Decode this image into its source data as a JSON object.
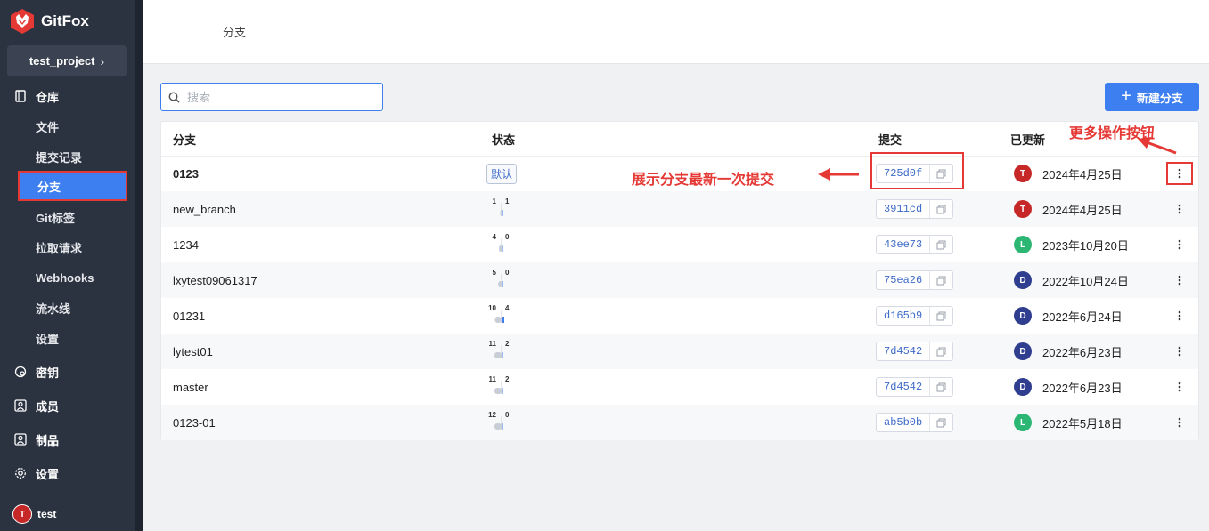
{
  "app": {
    "name": "GitFox",
    "brand_color": "#e53935",
    "accent_color": "#3d7ef0"
  },
  "project": {
    "name": "test_project"
  },
  "sidebar": {
    "repo_label": "仓库",
    "repo_items": [
      {
        "label": "文件",
        "active": false
      },
      {
        "label": "提交记录",
        "active": false
      },
      {
        "label": "分支",
        "active": true
      },
      {
        "label": "Git标签",
        "active": false
      },
      {
        "label": "拉取请求",
        "active": false
      },
      {
        "label": "Webhooks",
        "active": false
      },
      {
        "label": "流水线",
        "active": false
      },
      {
        "label": "设置",
        "active": false
      }
    ],
    "groups": [
      {
        "label": "密钥",
        "icon": "key-icon"
      },
      {
        "label": "成员",
        "icon": "member-icon"
      },
      {
        "label": "制品",
        "icon": "artifact-icon"
      },
      {
        "label": "设置",
        "icon": "gear-icon"
      }
    ],
    "user": {
      "initial": "T",
      "name": "test"
    }
  },
  "header": {
    "title": "分支"
  },
  "search": {
    "placeholder": "搜索",
    "value": ""
  },
  "new_branch_button": {
    "label": "新建分支"
  },
  "table": {
    "columns": {
      "branch": "分支",
      "status": "状态",
      "commit": "提交",
      "updated": "已更新"
    },
    "default_badge": "默认",
    "rows": [
      {
        "name": "0123",
        "is_default": true,
        "behind": null,
        "ahead": null,
        "commit": "725d0f",
        "avatar": "T",
        "avatar_color": "#c62828",
        "updated": "2024年4月25日"
      },
      {
        "name": "new_branch",
        "is_default": false,
        "behind": "1",
        "ahead": "1",
        "commit": "3911cd",
        "avatar": "T",
        "avatar_color": "#c62828",
        "updated": "2024年4月25日"
      },
      {
        "name": "1234",
        "is_default": false,
        "behind": "4",
        "ahead": "0",
        "commit": "43ee73",
        "avatar": "L",
        "avatar_color": "#2bb673",
        "updated": "2023年10月20日"
      },
      {
        "name": "lxytest09061317",
        "is_default": false,
        "behind": "5",
        "ahead": "0",
        "commit": "75ea26",
        "avatar": "D",
        "avatar_color": "#2f3e8f",
        "updated": "2022年10月24日"
      },
      {
        "name": "01231",
        "is_default": false,
        "behind": "10",
        "ahead": "4",
        "commit": "d165b9",
        "avatar": "D",
        "avatar_color": "#2f3e8f",
        "updated": "2022年6月24日"
      },
      {
        "name": "lytest01",
        "is_default": false,
        "behind": "11",
        "ahead": "2",
        "commit": "7d4542",
        "avatar": "D",
        "avatar_color": "#2f3e8f",
        "updated": "2022年6月23日"
      },
      {
        "name": "master",
        "is_default": false,
        "behind": "11",
        "ahead": "2",
        "commit": "7d4542",
        "avatar": "D",
        "avatar_color": "#2f3e8f",
        "updated": "2022年6月23日"
      },
      {
        "name": "0123-01",
        "is_default": false,
        "behind": "12",
        "ahead": "0",
        "commit": "ab5b0b",
        "avatar": "L",
        "avatar_color": "#2bb673",
        "updated": "2022年5月18日"
      }
    ]
  },
  "annotations": {
    "latest_commit": "展示分支最新一次提交",
    "more_actions": "更多操作按钮"
  }
}
